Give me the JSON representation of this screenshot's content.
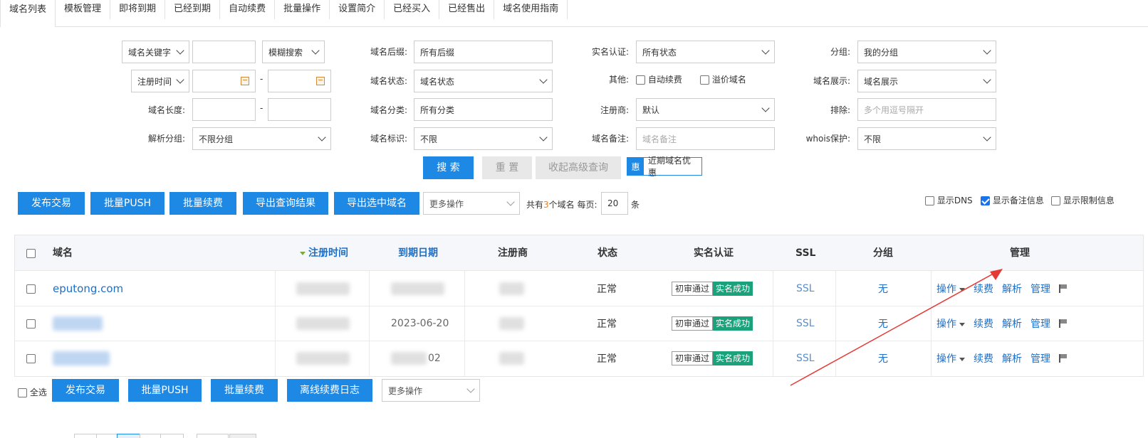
{
  "tabs": [
    "域名列表",
    "模板管理",
    "即将到期",
    "已经到期",
    "自动续费",
    "批量操作",
    "设置简介",
    "已经买入",
    "已经售出",
    "域名使用指南"
  ],
  "filters": {
    "keyword_select": "域名关键字",
    "match_select": "模糊搜索",
    "time_select": "注册时间",
    "dash": "-",
    "length_label": "域名长度:",
    "dns_group_label": "解析分组:",
    "dns_group_value": "不限分组",
    "suffix_label": "域名后缀:",
    "suffix_value": "所有后缀",
    "status_label": "域名状态:",
    "status_value": "域名状态",
    "category_label": "域名分类:",
    "category_value": "所有分类",
    "tag_label": "域名标识:",
    "tag_value": "不限",
    "auth_label": "实名认证:",
    "auth_value": "所有状态",
    "other_label": "其他:",
    "auto_renew": "自动续费",
    "premium": "溢价域名",
    "registrar_label": "注册商:",
    "registrar_value": "默认",
    "remark_label": "域名备注:",
    "remark_placeholder": "域名备注",
    "group_label": "分组:",
    "group_value": "我的分组",
    "display_label": "域名展示:",
    "display_value": "域名展示",
    "exclude_label": "排除:",
    "exclude_placeholder": "多个用逗号隔开",
    "whois_label": "whois保护:",
    "whois_value": "不限"
  },
  "search_buttons": {
    "search": "搜 索",
    "reset": "重 置",
    "collapse": "收起高级查询",
    "promo_badge": "惠",
    "promo_text": "近期域名优惠"
  },
  "toolbar": {
    "publish": "发布交易",
    "push": "批量PUSH",
    "renew": "批量续费",
    "export_results": "导出查询结果",
    "export_selected": "导出选中域名",
    "more": "更多操作",
    "total_prefix": "共有",
    "total_count": "3",
    "total_suffix": "个域名 每页:",
    "per_page": "20",
    "per_page_unit": "条",
    "show_dns": "显示DNS",
    "show_remark": "显示备注信息",
    "show_limit": "显示限制信息"
  },
  "table": {
    "headers": [
      "域名",
      "注册时间",
      "到期日期",
      "注册商",
      "状态",
      "实名认证",
      "SSL",
      "分组",
      "管理"
    ],
    "rows": [
      {
        "domain": "eputong.com",
        "expire": "",
        "status": "正常",
        "auth1": "初审通过",
        "auth2": "实名成功",
        "ssl": "SSL",
        "group": "无"
      },
      {
        "domain": "",
        "expire": "2023-06-20",
        "status": "正常",
        "auth1": "初审通过",
        "auth2": "实名成功",
        "ssl": "SSL",
        "group": "无"
      },
      {
        "domain": "",
        "expire": "02",
        "status": "正常",
        "auth1": "初审通过",
        "auth2": "实名成功",
        "ssl": "SSL",
        "group": "无"
      }
    ],
    "ops": {
      "operate": "操作",
      "renew": "续费",
      "dns": "解析",
      "manage": "管理"
    }
  },
  "bottom": {
    "select_all": "全选",
    "publish": "发布交易",
    "push": "批量PUSH",
    "renew": "批量续费",
    "offline_log": "离线续费日志",
    "more": "更多操作"
  },
  "colors": {
    "primary": "#1e88e5",
    "success": "#1aa37a",
    "link": "#1e6fc6",
    "arrow": "#e53935"
  }
}
